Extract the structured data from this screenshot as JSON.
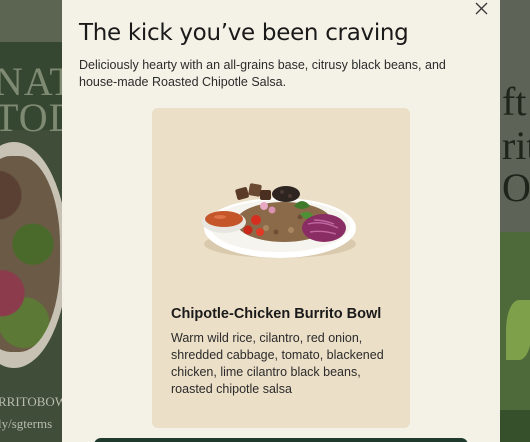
{
  "background": {
    "left_words": [
      "NAT",
      "TOD"
    ],
    "left_link_lines": [
      "RRITOBOW",
      "ly/sgterms"
    ],
    "right_words": [
      "ft",
      "rit",
      "OD"
    ]
  },
  "modal": {
    "close_icon": "close-icon",
    "title": "The kick you’ve been craving",
    "subtitle": "Deliciously hearty with an all-grains base, citrusy black beans, and house-made Roasted Chipotle Salsa.",
    "card": {
      "image_icon": "burrito-bowl-image",
      "title": "Chipotle-Chicken Burrito Bowl",
      "description": "Warm wild rice, cilantro, red onion, shredded cabbage, tomato, blackened chicken, lime cilantro black beans, roasted chipotle salsa"
    }
  },
  "colors": {
    "modal_bg": "#f4f2e7",
    "card_bg": "#ecdfc8",
    "cta_bg": "#203a2e",
    "text": "#1a1a1a"
  }
}
